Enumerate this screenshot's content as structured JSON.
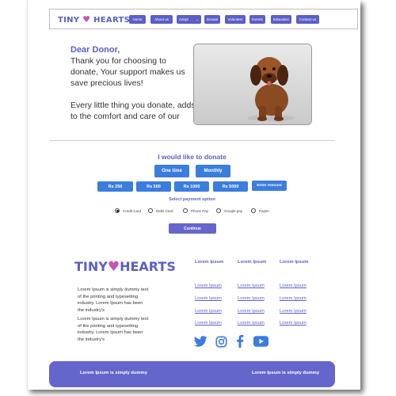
{
  "brand": {
    "left": "TINY",
    "right": "HEARTS",
    "heart": "♥"
  },
  "nav": {
    "items": [
      {
        "label": "Home"
      },
      {
        "label": "About us"
      },
      {
        "label": "Adopt"
      },
      {
        "label": "Donate"
      },
      {
        "label": "Volunteer"
      },
      {
        "label": "Events"
      },
      {
        "label": "Education"
      },
      {
        "label": "Contact us"
      }
    ],
    "adopt_caret": "⌄"
  },
  "hero": {
    "greeting": "Dear Donor,",
    "para1": "Thank you for choosing to donate, Your support makes us save precious lives!",
    "para2": "Every little thing you donate, adds to the comfort and care of our"
  },
  "donate": {
    "title": "I would like to donate",
    "frequency": [
      "One time",
      "Monthly"
    ],
    "amounts": [
      "Rs 250",
      "Rs 500",
      "Rs 1000",
      "Rs 5000",
      "Enter Amount"
    ],
    "payment_title": "Select payment option",
    "payment_options": [
      {
        "label": "Credit Card",
        "selected": true
      },
      {
        "label": "Debit Card",
        "selected": false
      },
      {
        "label": "Phone Pay",
        "selected": false
      },
      {
        "label": "Google pay",
        "selected": false
      },
      {
        "label": "Paytm",
        "selected": false
      }
    ],
    "continue_label": "Continue"
  },
  "footer": {
    "lorem1": "Lorem Ipsum is simply dummy text of the printing and typesetting industry. Lorem Ipsum has been the industry's",
    "lorem2": "Lorem Ipsum is simply dummy text of the printing and typesetting industry. Lorem Ipsum has been the industry's",
    "col_heads": [
      "Lorem Ipsum",
      "Lorem Ipsum",
      "Lorem Ipsum"
    ],
    "link": "Lorem Ipsum",
    "social": [
      "twitter-icon",
      "instagram-icon",
      "facebook-icon",
      "youtube-icon"
    ],
    "bar_left": "Lorem Ipsum is simply dummy",
    "bar_right": "Lorem Ipsum is simply dummy"
  },
  "colors": {
    "brand": "#5b5fc7",
    "heart": "#c554b6",
    "button": "#3b7ddd",
    "bar": "#6566cc"
  }
}
